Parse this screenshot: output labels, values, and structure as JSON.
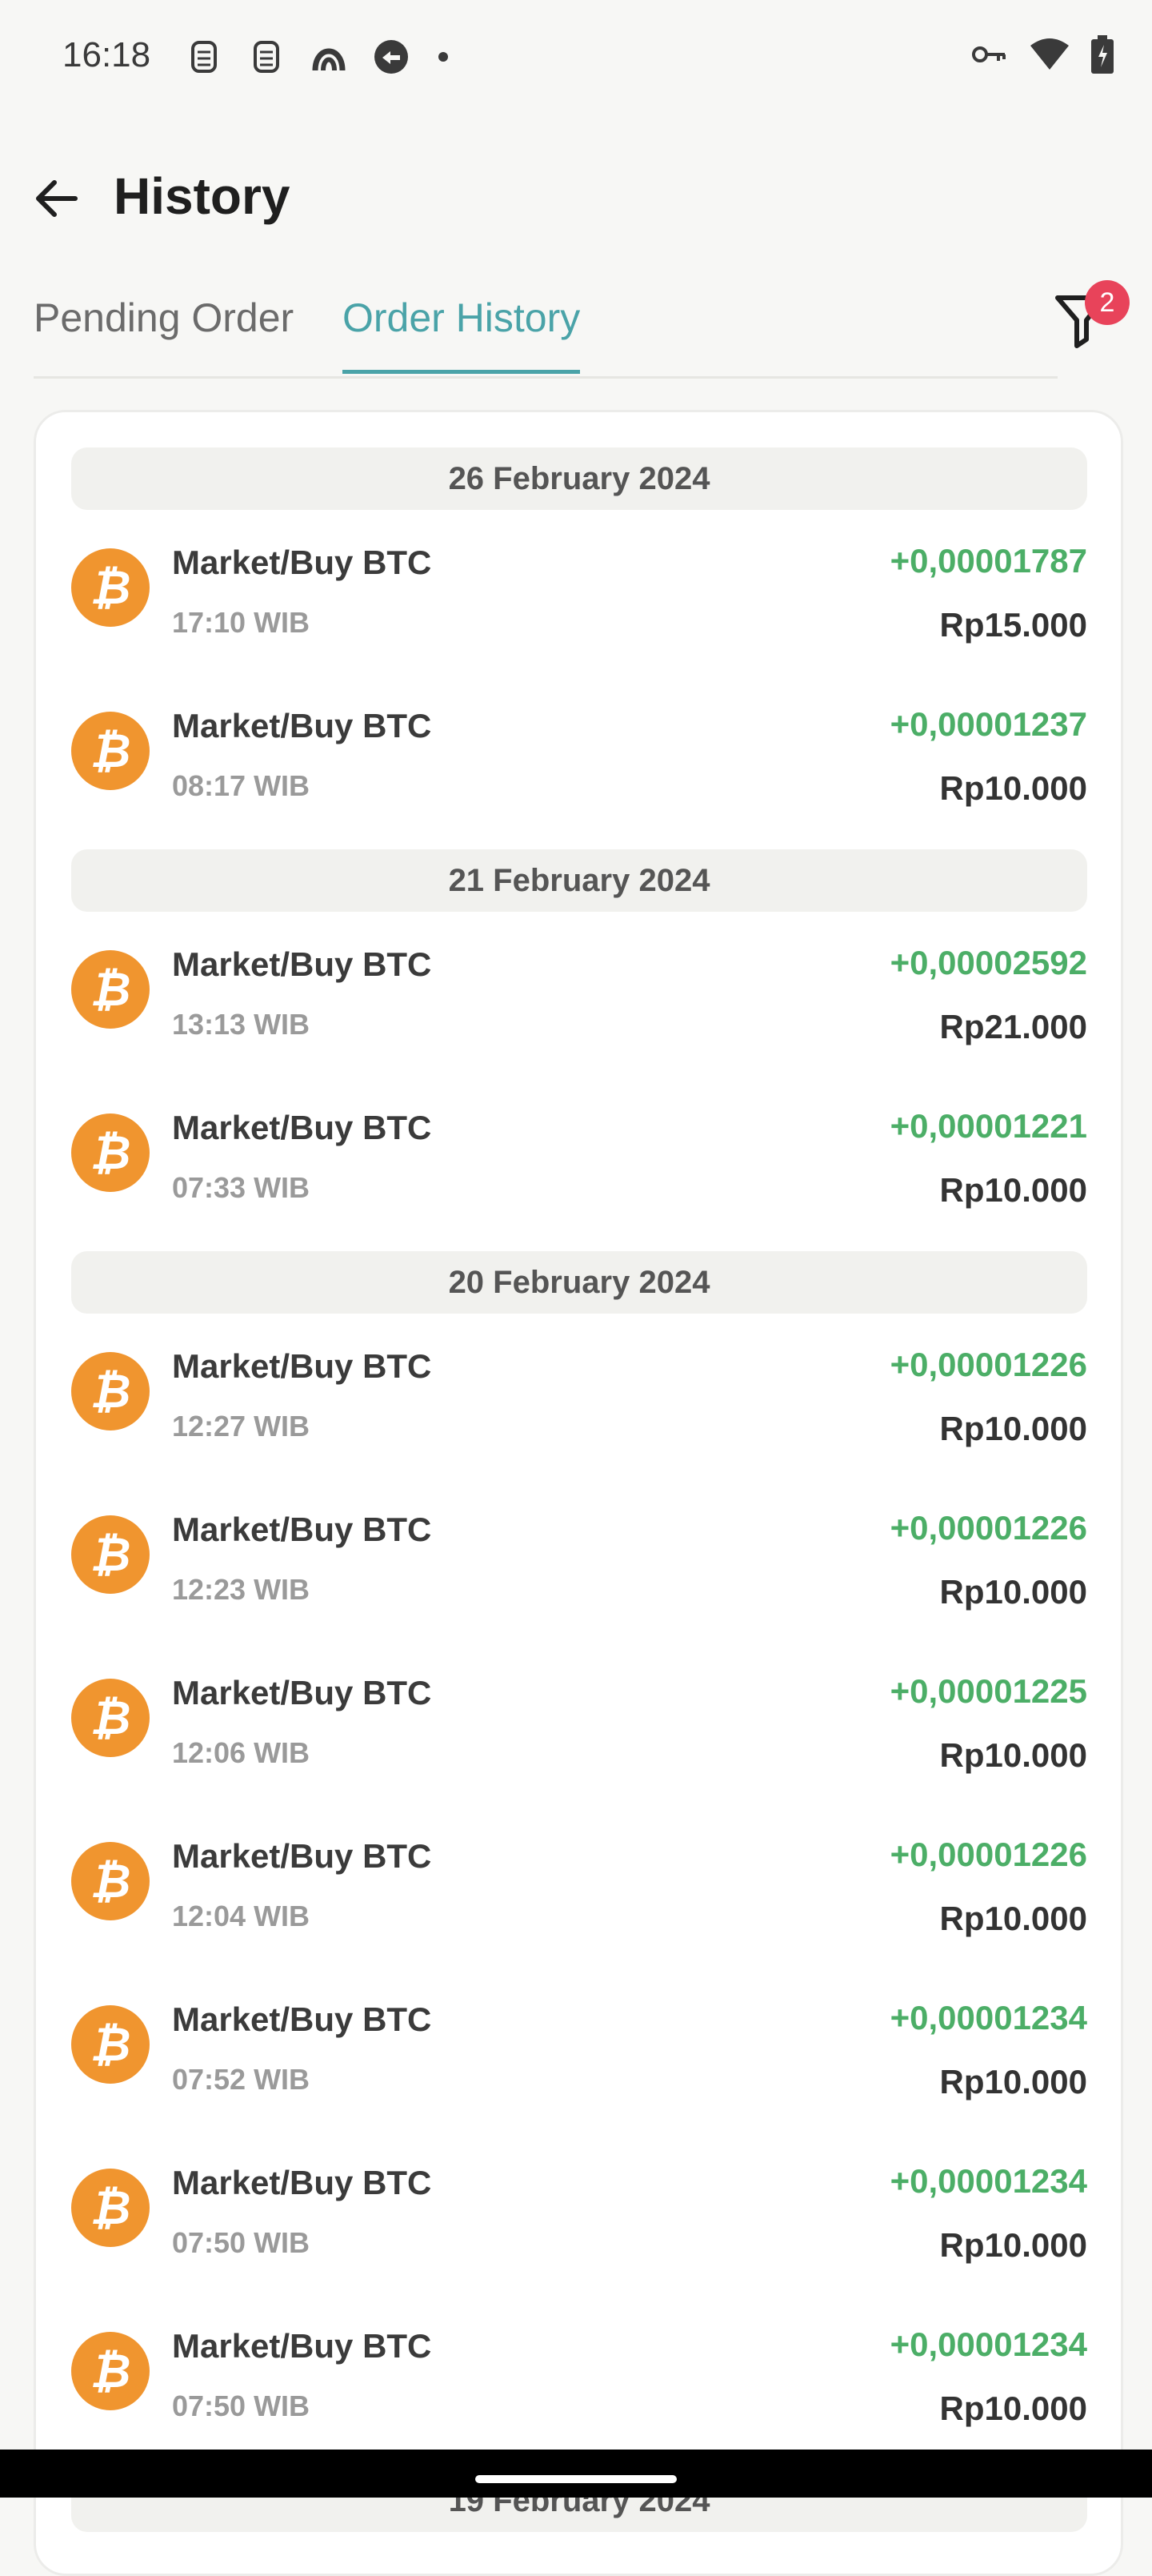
{
  "status_bar": {
    "time": "16:18",
    "icons": [
      "sim-icon",
      "sim-icon",
      "app-icon",
      "app-icon",
      "dot-icon",
      "key-icon",
      "wifi-icon",
      "battery-icon"
    ]
  },
  "header": {
    "title": "History",
    "back_icon": "arrow-left-icon"
  },
  "tabs": {
    "pending": "Pending Order",
    "history": "Order History",
    "active": "Order History"
  },
  "filter": {
    "icon": "filter-icon",
    "badge": "2"
  },
  "colors": {
    "accent": "#4aa3a8",
    "positive": "#4cae67",
    "coin": "#f0952f",
    "badge": "#e8435a"
  },
  "groups": [
    {
      "date": "26 February 2024",
      "items": [
        {
          "label": "Market/Buy BTC",
          "time": "17:10 WIB",
          "amount": "+0,00001787",
          "price": "Rp15.000"
        },
        {
          "label": "Market/Buy BTC",
          "time": "08:17 WIB",
          "amount": "+0,00001237",
          "price": "Rp10.000"
        }
      ]
    },
    {
      "date": "21 February 2024",
      "items": [
        {
          "label": "Market/Buy BTC",
          "time": "13:13 WIB",
          "amount": "+0,00002592",
          "price": "Rp21.000"
        },
        {
          "label": "Market/Buy BTC",
          "time": "07:33 WIB",
          "amount": "+0,00001221",
          "price": "Rp10.000"
        }
      ]
    },
    {
      "date": "20 February 2024",
      "items": [
        {
          "label": "Market/Buy BTC",
          "time": "12:27 WIB",
          "amount": "+0,00001226",
          "price": "Rp10.000"
        },
        {
          "label": "Market/Buy BTC",
          "time": "12:23 WIB",
          "amount": "+0,00001226",
          "price": "Rp10.000"
        },
        {
          "label": "Market/Buy BTC",
          "time": "12:06 WIB",
          "amount": "+0,00001225",
          "price": "Rp10.000"
        },
        {
          "label": "Market/Buy BTC",
          "time": "12:04 WIB",
          "amount": "+0,00001226",
          "price": "Rp10.000"
        },
        {
          "label": "Market/Buy BTC",
          "time": "07:52 WIB",
          "amount": "+0,00001234",
          "price": "Rp10.000"
        },
        {
          "label": "Market/Buy BTC",
          "time": "07:50 WIB",
          "amount": "+0,00001234",
          "price": "Rp10.000"
        },
        {
          "label": "Market/Buy BTC",
          "time": "07:50 WIB",
          "amount": "+0,00001234",
          "price": "Rp10.000"
        }
      ]
    },
    {
      "date": "19 February 2024",
      "items": []
    }
  ]
}
